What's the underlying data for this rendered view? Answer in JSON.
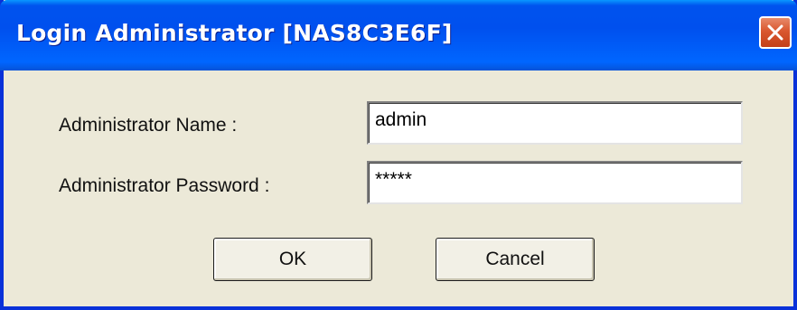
{
  "window": {
    "title": "Login Administrator [NAS8C3E6F]"
  },
  "form": {
    "name_label": "Administrator Name :",
    "name_value": "admin",
    "password_label": "Administrator Password :",
    "password_value": "*****"
  },
  "buttons": {
    "ok_label": "OK",
    "cancel_label": "Cancel"
  },
  "colors": {
    "titlebar": "#0054e3",
    "dialog_bg": "#ece9d8",
    "close_button": "#d9572f"
  },
  "icons": {
    "close": "close-icon"
  }
}
